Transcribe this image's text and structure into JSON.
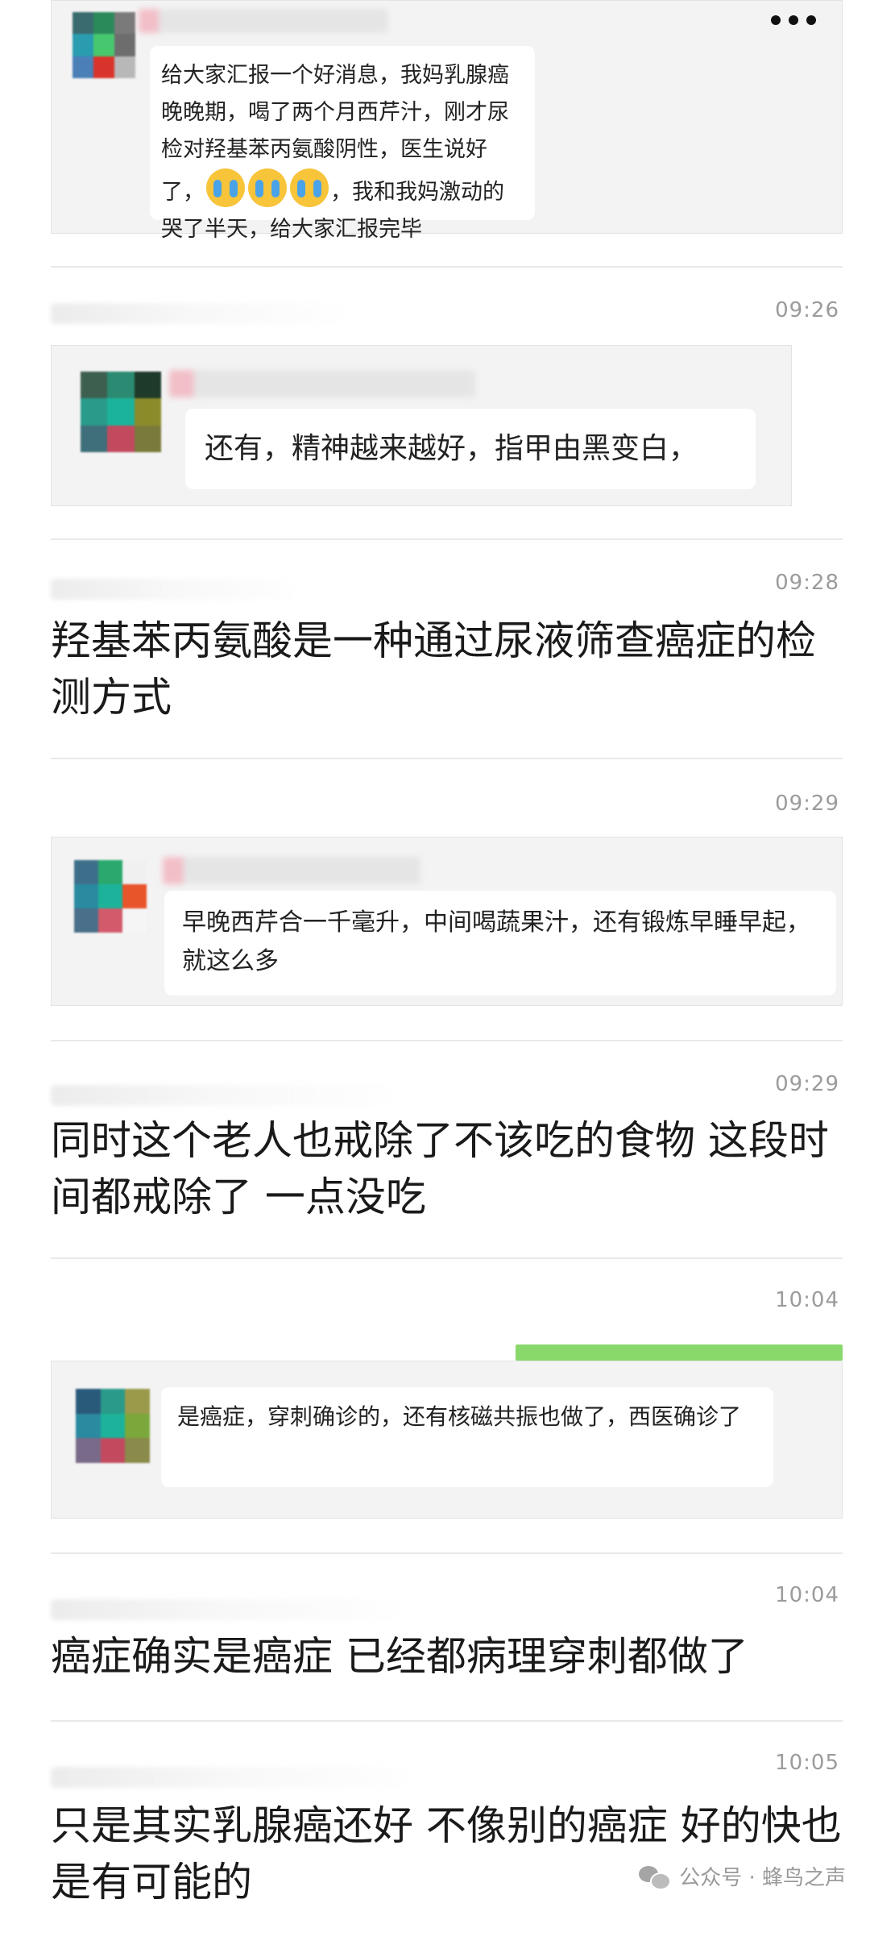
{
  "colors": {
    "background": "#ffffff",
    "card": "#f3f3f3",
    "bubble": "#ffffff",
    "time": "#9b9b9b",
    "accent_green": "#89d86b"
  },
  "top_card": {
    "message_before": "给大家汇报一个好消息，我妈乳腺癌晚晚期，喝了两个月西芹汁，刚才尿检对羟基苯丙氨酸阴性，医生说好了，",
    "emoji": [
      "crying-face",
      "crying-face",
      "crying-face"
    ],
    "message_after": "，我和我妈激动的哭了半天，给大家汇报完毕"
  },
  "posts": [
    {
      "time": "09:26",
      "quote": "还有，精神越来越好，指甲由黑变白，"
    },
    {
      "time": "09:28",
      "text": "羟基苯丙氨酸是一种通过尿液筛查癌症的检测方式"
    },
    {
      "time": "09:29",
      "quote": "早晚西芹合一千毫升，中间喝蔬果汁，还有锻炼早睡早起，就这么多"
    },
    {
      "time": "09:29",
      "text": "同时这个老人也戒除了不该吃的食物 这段时间都戒除了  一点没吃"
    },
    {
      "time": "10:04",
      "quote": "是癌症，穿刺确诊的，还有核磁共振也做了，西医确诊了"
    },
    {
      "time": "10:04",
      "text": "癌症确实是癌症 已经都病理穿刺都做了"
    },
    {
      "time": "10:05",
      "text": "只是其实乳腺癌还好 不像别的癌症 好的快也是有可能的"
    }
  ],
  "watermark": {
    "icon": "wechat-icon",
    "text": "公众号 · 蜂鸟之声"
  }
}
